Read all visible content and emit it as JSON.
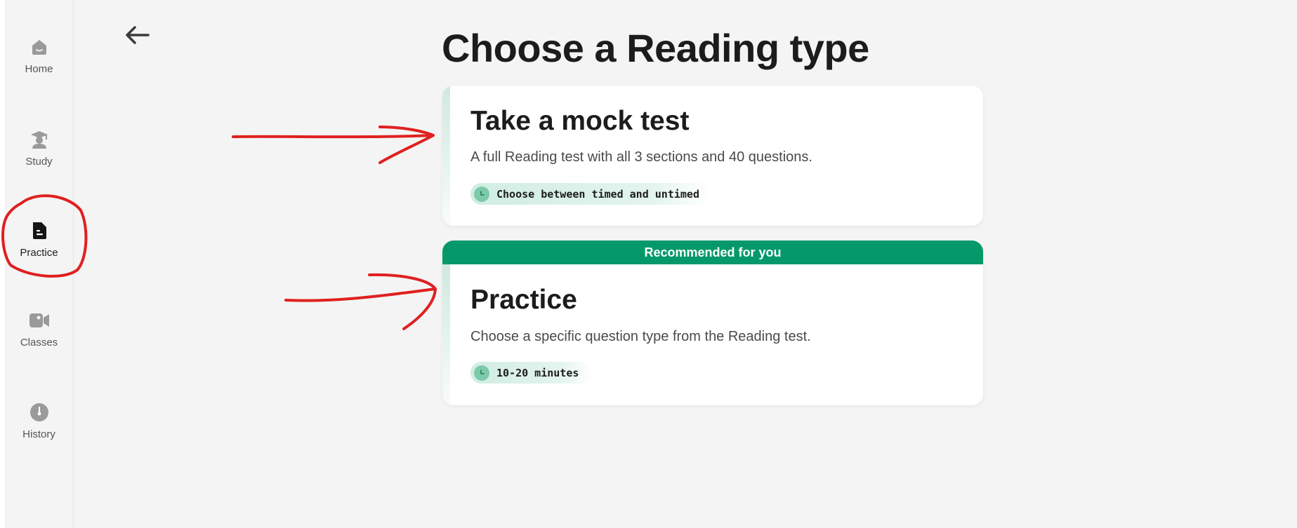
{
  "sidebar": {
    "items": [
      {
        "label": "Home",
        "icon": "home-icon",
        "active": false
      },
      {
        "label": "Study",
        "icon": "graduation-cap-icon",
        "active": false
      },
      {
        "label": "Practice",
        "icon": "document-icon",
        "active": true
      },
      {
        "label": "Classes",
        "icon": "video-camera-icon",
        "active": false
      },
      {
        "label": "History",
        "icon": "clock-icon",
        "active": false
      }
    ]
  },
  "header": {
    "back_icon": "back-arrow-icon",
    "title": "Choose a Reading type"
  },
  "cards": {
    "mock": {
      "title": "Take a mock test",
      "description": "A full Reading test with all 3 sections and 40 questions.",
      "chip": "Choose between timed and untimed"
    },
    "practice": {
      "banner": "Recommended for you",
      "title": "Practice",
      "description": "Choose a specific question type from the Reading test.",
      "chip": "10-20 minutes"
    }
  },
  "colors": {
    "accent_green": "#05996a",
    "chip_bg": "#d1ede3",
    "clock_green": "#7ccaa9",
    "annotation_red": "#e02020",
    "background": "#f4f4f4"
  }
}
